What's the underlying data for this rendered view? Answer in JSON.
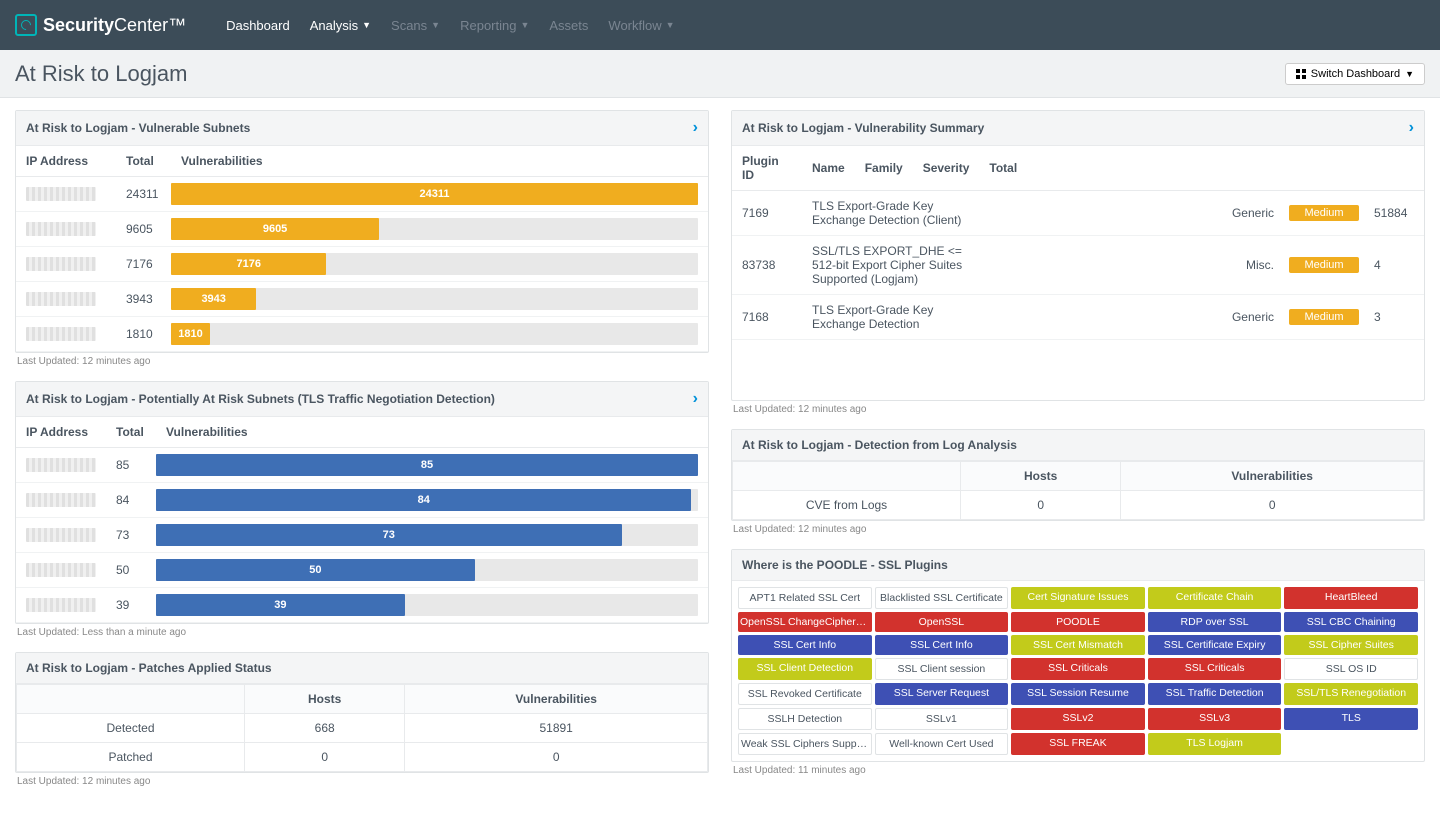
{
  "brand": {
    "name1": "Security",
    "name2": "Center"
  },
  "nav": {
    "dashboard": "Dashboard",
    "analysis": "Analysis",
    "scans": "Scans",
    "reporting": "Reporting",
    "assets": "Assets",
    "workflow": "Workflow"
  },
  "page_title": "At Risk to Logjam",
  "switch_label": "Switch Dashboard",
  "panels": {
    "vulnerable_subnets": {
      "title": "At Risk to Logjam - Vulnerable Subnets",
      "cols": {
        "ip": "IP Address",
        "total": "Total",
        "vuln": "Vulnerabilities"
      },
      "max": 24311,
      "rows": [
        {
          "total": 24311,
          "label": "24311"
        },
        {
          "total": 9605,
          "label": "9605"
        },
        {
          "total": 7176,
          "label": "7176"
        },
        {
          "total": 3943,
          "label": "3943"
        },
        {
          "total": 1810,
          "label": "1810"
        }
      ],
      "updated": "Last Updated: 12 minutes ago"
    },
    "potential_subnets": {
      "title": "At Risk to Logjam - Potentially At Risk Subnets (TLS Traffic Negotiation Detection)",
      "cols": {
        "ip": "IP Address",
        "total": "Total",
        "vuln": "Vulnerabilities"
      },
      "max": 85,
      "rows": [
        {
          "total": 85,
          "label": "85"
        },
        {
          "total": 84,
          "label": "84"
        },
        {
          "total": 73,
          "label": "73"
        },
        {
          "total": 50,
          "label": "50"
        },
        {
          "total": 39,
          "label": "39"
        }
      ],
      "updated": "Last Updated: Less than a minute ago"
    },
    "patches": {
      "title": "At Risk to Logjam - Patches Applied Status",
      "cols": {
        "blank": "",
        "hosts": "Hosts",
        "vuln": "Vulnerabilities"
      },
      "rows": [
        {
          "label": "Detected",
          "hosts": "668",
          "vuln": "51891"
        },
        {
          "label": "Patched",
          "hosts": "0",
          "vuln": "0"
        }
      ],
      "updated": "Last Updated: 12 minutes ago"
    },
    "vuln_summary": {
      "title": "At Risk to Logjam - Vulnerability Summary",
      "cols": {
        "plugin": "Plugin ID",
        "name": "Name",
        "family": "Family",
        "severity": "Severity",
        "total": "Total"
      },
      "rows": [
        {
          "plugin": "7169",
          "name": "TLS Export-Grade Key Exchange Detection (Client)",
          "family": "Generic",
          "severity": "Medium",
          "total": "51884"
        },
        {
          "plugin": "83738",
          "name": "SSL/TLS EXPORT_DHE <= 512-bit Export Cipher Suites Supported (Logjam)",
          "family": "Misc.",
          "severity": "Medium",
          "total": "4"
        },
        {
          "plugin": "7168",
          "name": "TLS Export-Grade Key Exchange Detection",
          "family": "Generic",
          "severity": "Medium",
          "total": "3"
        }
      ],
      "updated": "Last Updated: 12 minutes ago"
    },
    "log_analysis": {
      "title": "At Risk to Logjam - Detection from Log Analysis",
      "cols": {
        "blank": "",
        "hosts": "Hosts",
        "vuln": "Vulnerabilities"
      },
      "rows": [
        {
          "label": "CVE from Logs",
          "hosts": "0",
          "vuln": "0"
        }
      ],
      "updated": "Last Updated: 12 minutes ago"
    },
    "poodle": {
      "title": "Where is the POODLE - SSL Plugins",
      "cells": [
        {
          "t": "APT1 Related SSL Cert",
          "c": "white"
        },
        {
          "t": "Blacklisted SSL Certificate",
          "c": "white"
        },
        {
          "t": "Cert Signature Issues",
          "c": "olive"
        },
        {
          "t": "Certificate Chain",
          "c": "olive"
        },
        {
          "t": "HeartBleed",
          "c": "red"
        },
        {
          "t": "OpenSSL ChangeCipherSpec",
          "c": "red"
        },
        {
          "t": "OpenSSL",
          "c": "red"
        },
        {
          "t": "POODLE",
          "c": "red"
        },
        {
          "t": "RDP over SSL",
          "c": "blue"
        },
        {
          "t": "SSL CBC Chaining",
          "c": "blue"
        },
        {
          "t": "SSL Cert Info",
          "c": "blue"
        },
        {
          "t": "SSL Cert Info",
          "c": "blue"
        },
        {
          "t": "SSL Cert Mismatch",
          "c": "olive"
        },
        {
          "t": "SSL Certificate Expiry",
          "c": "blue"
        },
        {
          "t": "SSL Cipher Suites",
          "c": "olive"
        },
        {
          "t": "SSL Client Detection",
          "c": "olive"
        },
        {
          "t": "SSL Client session",
          "c": "white"
        },
        {
          "t": "SSL Criticals",
          "c": "red"
        },
        {
          "t": "SSL Criticals",
          "c": "red"
        },
        {
          "t": "SSL OS ID",
          "c": "white"
        },
        {
          "t": "SSL Revoked Certificate",
          "c": "white"
        },
        {
          "t": "SSL Server Request",
          "c": "blue"
        },
        {
          "t": "SSL Session Resume",
          "c": "blue"
        },
        {
          "t": "SSL Traffic Detection",
          "c": "blue"
        },
        {
          "t": "SSL/TLS Renegotiation",
          "c": "olive"
        },
        {
          "t": "SSLH Detection",
          "c": "white"
        },
        {
          "t": "SSLv1",
          "c": "white"
        },
        {
          "t": "SSLv2",
          "c": "red"
        },
        {
          "t": "SSLv3",
          "c": "red"
        },
        {
          "t": "TLS",
          "c": "blue"
        },
        {
          "t": "Weak SSL Ciphers Supported",
          "c": "white"
        },
        {
          "t": "Well-known Cert Used",
          "c": "white"
        },
        {
          "t": "SSL FREAK",
          "c": "red"
        },
        {
          "t": "TLS Logjam",
          "c": "olive"
        }
      ],
      "updated": "Last Updated: 11 minutes ago"
    }
  }
}
